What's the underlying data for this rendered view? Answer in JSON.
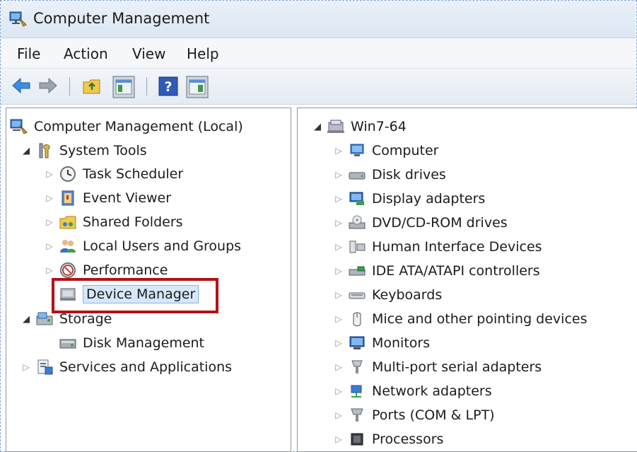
{
  "window": {
    "title": "Computer Management"
  },
  "menu": {
    "file": "File",
    "action": "Action",
    "view": "View",
    "help": "Help"
  },
  "left_tree": {
    "root": "Computer Management (Local)",
    "system_tools": "System Tools",
    "task_scheduler": "Task Scheduler",
    "event_viewer": "Event Viewer",
    "shared_folders": "Shared Folders",
    "local_users": "Local Users and Groups",
    "performance": "Performance",
    "device_manager": "Device Manager",
    "storage": "Storage",
    "disk_management": "Disk Management",
    "services_apps": "Services and Applications"
  },
  "right_tree": {
    "root": "Win7-64",
    "items": [
      "Computer",
      "Disk drives",
      "Display adapters",
      "DVD/CD-ROM drives",
      "Human Interface Devices",
      "IDE ATA/ATAPI controllers",
      "Keyboards",
      "Mice and other pointing devices",
      "Monitors",
      "Multi-port serial adapters",
      "Network adapters",
      "Ports (COM & LPT)",
      "Processors"
    ]
  },
  "colors": {
    "highlight_border": "#b31217",
    "selection": "#d6e8fb"
  }
}
